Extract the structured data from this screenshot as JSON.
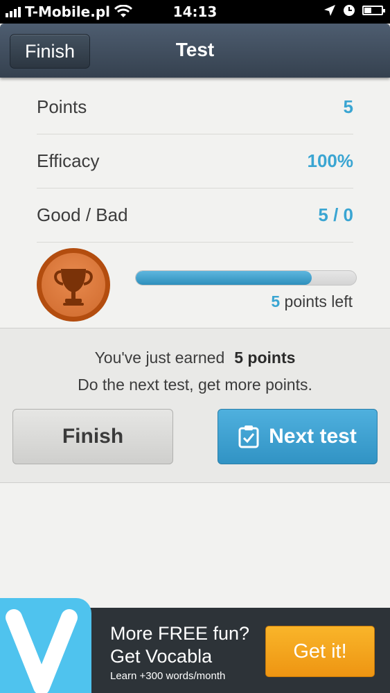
{
  "status_bar": {
    "carrier": "T-Mobile.pl",
    "time": "14:13",
    "icons": [
      "signal-icon",
      "wifi-icon",
      "location-arrow-icon",
      "alarm-clock-icon",
      "battery-icon"
    ]
  },
  "nav": {
    "back_label": "Finish",
    "title": "Test"
  },
  "stats": [
    {
      "label": "Points",
      "value": "5"
    },
    {
      "label": "Efficacy",
      "value": "100%"
    },
    {
      "label": "Good / Bad",
      "value": "5 / 0"
    }
  ],
  "progress": {
    "fraction": 0.8,
    "points_left_number": "5",
    "points_left_text": " points left"
  },
  "earned": {
    "prefix": "You've just earned",
    "points": "5 points",
    "message": "Do the next test, get more points."
  },
  "buttons": {
    "finish": "Finish",
    "next": "Next test"
  },
  "ad": {
    "line1": "More FREE fun?",
    "line2": "Get Vocabla",
    "line3": "Learn +300 words/month",
    "cta": "Get it!"
  },
  "colors": {
    "accent": "#3aa5d2",
    "nav_bar": "#3f4b5a",
    "trophy": "#cf6a2d",
    "cta_orange": "#f5a623",
    "ad_logo": "#4fc3ee"
  }
}
